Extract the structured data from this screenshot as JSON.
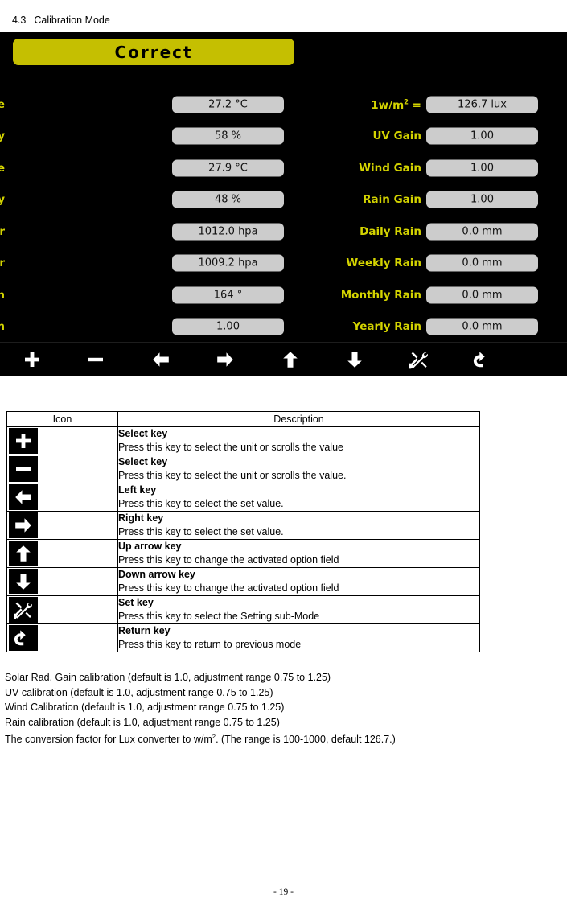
{
  "heading": {
    "number": "4.3",
    "title": "Calibration Mode"
  },
  "device": {
    "mode_title": "Correct",
    "title_color": "#c5bf01",
    "label_color": "#d4d400",
    "value_box_color": "#cccccc",
    "screen_color": "#000000",
    "left_column": [
      {
        "label": "Indoor Temperature",
        "value": "27.2 °C"
      },
      {
        "label": "Indoor Humidity",
        "value": "58 %"
      },
      {
        "label": "Outdoor Temperature",
        "value": "27.9 °C"
      },
      {
        "label": "Outdoor Humidity",
        "value": "48 %"
      },
      {
        "label": "ABS Barometer",
        "value": "1012.0 hpa"
      },
      {
        "label": "REL Barometer",
        "value": "1009.2 hpa"
      },
      {
        "label": "Wind Direction",
        "value": "164 °"
      },
      {
        "label": "Solar Rad. Gain",
        "value": "1.00"
      }
    ],
    "right_column": [
      {
        "label": "1w/m² =",
        "label_html": "1w/m<sup class=\"sup\">2</sup> =",
        "value": "126.7 lux"
      },
      {
        "label": "UV Gain",
        "value": "1.00"
      },
      {
        "label": "Wind Gain",
        "value": "1.00"
      },
      {
        "label": "Rain Gain",
        "value": "1.00"
      },
      {
        "label": "Daily Rain",
        "value": "0.0 mm"
      },
      {
        "label": "Weekly Rain",
        "value": "0.0 mm"
      },
      {
        "label": "Monthly Rain",
        "value": "0.0 mm"
      },
      {
        "label": "Yearly Rain",
        "value": "0.0 mm"
      }
    ],
    "toolbar": [
      {
        "icon": "plus-icon"
      },
      {
        "icon": "minus-icon"
      },
      {
        "icon": "arrow-left-icon"
      },
      {
        "icon": "arrow-right-icon"
      },
      {
        "icon": "arrow-up-icon"
      },
      {
        "icon": "arrow-down-icon"
      },
      {
        "icon": "tools-icon"
      },
      {
        "icon": "return-icon"
      }
    ]
  },
  "key_table": {
    "headers": [
      "Icon",
      "Description"
    ],
    "rows": [
      {
        "icon": "plus-icon",
        "title": "Select key",
        "body": "Press this key to select the unit or scrolls the value"
      },
      {
        "icon": "minus-icon",
        "title": "Select key",
        "body": "Press this key to select the unit or scrolls the value."
      },
      {
        "icon": "arrow-left-icon",
        "title": "Left key",
        "body": "Press this key to select the set value."
      },
      {
        "icon": "arrow-right-icon",
        "title": "Right key",
        "body": "Press this key to select the set value."
      },
      {
        "icon": "arrow-up-icon",
        "title": "Up arrow key",
        "body": "Press this key to change the activated option field"
      },
      {
        "icon": "arrow-down-icon",
        "title": "Down arrow key",
        "body": "Press this key to change the activated option field"
      },
      {
        "icon": "tools-icon",
        "title": "Set key",
        "body": "Press this key to select the Setting sub-Mode"
      },
      {
        "icon": "return-icon",
        "title": "Return key",
        "body": "Press this key to return to previous mode"
      }
    ]
  },
  "notes": [
    "Solar Rad. Gain calibration (default is 1.0, adjustment range 0.75 to 1.25)",
    "UV calibration (default is 1.0, adjustment range 0.75 to 1.25)",
    "Wind Calibration (default is 1.0, adjustment range 0.75 to 1.25)",
    "Rain calibration (default is 1.0, adjustment range 0.75 to 1.25)"
  ],
  "note_lux": {
    "prefix": "The conversion factor for Lux converter to w/m",
    "sup": "2",
    "suffix": ". (The range is 100-1000, default 126.7.)"
  },
  "page_footer": "- 19 -"
}
